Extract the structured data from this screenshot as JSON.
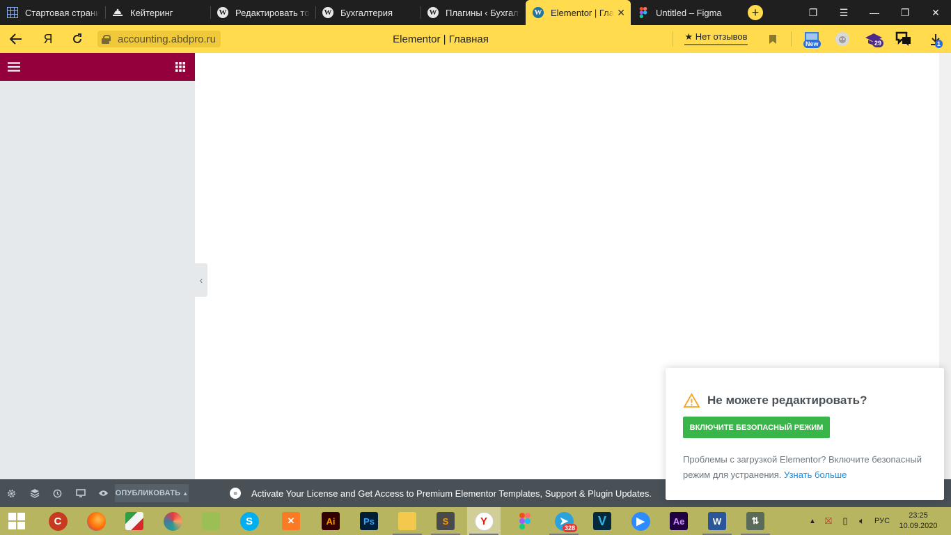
{
  "browser": {
    "tabs": [
      {
        "title": "Стартовая страница",
        "icon": "grid-icon",
        "active": false
      },
      {
        "title": "Кейтеринг",
        "icon": "catering-icon",
        "active": false
      },
      {
        "title": "Редактировать товар",
        "icon": "wordpress-icon",
        "active": false
      },
      {
        "title": "Бухгалтерия",
        "icon": "wordpress-icon",
        "active": false
      },
      {
        "title": "Плагины ‹ Бухгалтерия",
        "icon": "wordpress-icon",
        "active": false
      },
      {
        "title": "Elementor | Главная",
        "icon": "wordpress-icon",
        "active": true
      },
      {
        "title": "Untitled – Figma",
        "icon": "figma-icon",
        "active": false
      }
    ],
    "url": "accounting.abdpro.ru",
    "page_title": "Elementor | Главная",
    "reviews_label": "★ Нет отзывов",
    "ext_badges": {
      "new_label": "New",
      "mail_count": "29",
      "downloads_count": "1"
    },
    "accent_color": "#ffdb4d"
  },
  "elementor": {
    "panel_header_color": "#93003c",
    "publish_label": "ОПУБЛИКОВАТЬ",
    "license_banner": "Activate Your License and Get Access to Premium Elementor Templates, Support & Plugin Updates."
  },
  "safe_mode_dialog": {
    "title": "Не можете редактировать?",
    "button_label": "ВКЛЮЧИТЕ БЕЗОПАСНЫЙ РЕЖИМ",
    "text": "Проблемы с загрузкой Elementor? Включите безопасный режим для устранения.",
    "link_text": "Узнать больше",
    "button_color": "#39b54a"
  },
  "taskbar": {
    "apps": [
      "CCleaner",
      "Firefox",
      "WinRAR",
      "Paint",
      "Notepad",
      "Skype",
      "XAMPP",
      "Illustrator",
      "Photoshop",
      "File Explorer",
      "Sublime Text",
      "Yandex Browser",
      "Figma",
      "Telegram",
      "Vectorworks",
      "Zoom",
      "After Effects",
      "Word",
      "Network"
    ],
    "ai_label": "Ai",
    "ps_label": "Ps",
    "ae_label": "Ae",
    "v_label": "V",
    "telegram_badge": "328",
    "language": "РУС",
    "time": "23:25",
    "date": "10.09.2020"
  }
}
